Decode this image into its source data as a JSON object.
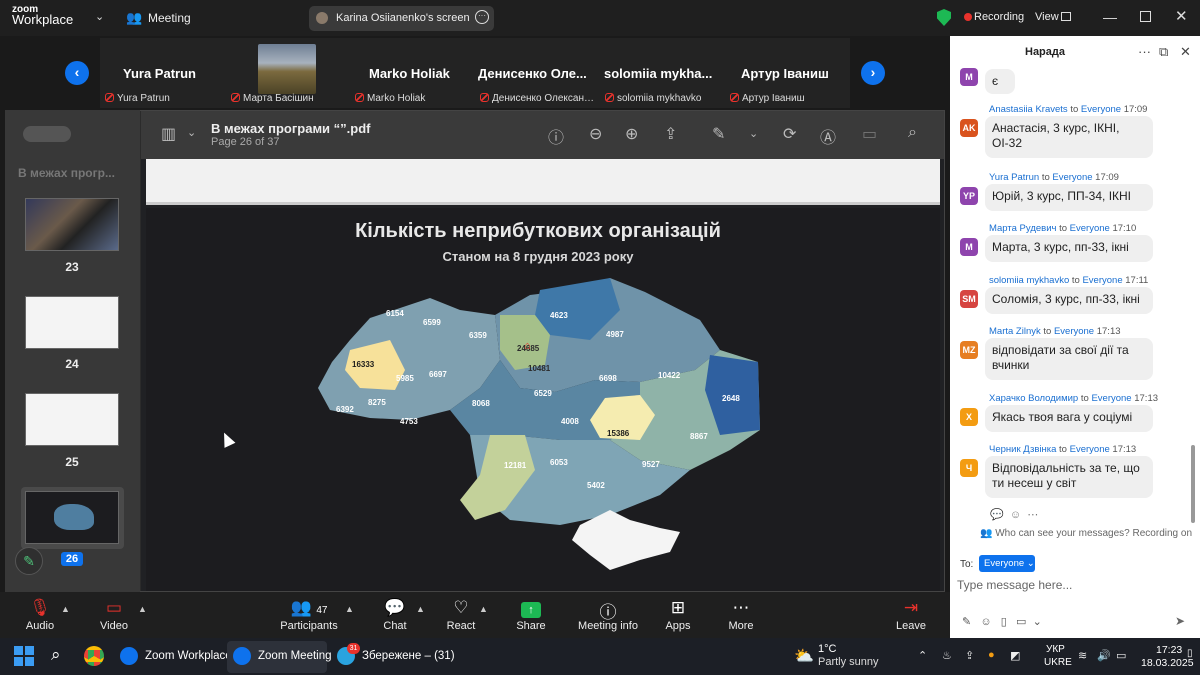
{
  "topbar": {
    "logo_line1": "zoom",
    "logo_line2": "Workplace",
    "meeting_label": "Meeting",
    "screen_share_label": "Karina Osiianenko's screen",
    "recording_label": "Recording",
    "view_label": "View"
  },
  "participants": [
    {
      "name": "Yura Patrun",
      "tile_label": "Yura Patrun"
    },
    {
      "name": "",
      "tile_label": "Марта Басішин"
    },
    {
      "name": "Marko Holiak",
      "tile_label": "Marko Holiak"
    },
    {
      "name": "Денисенко Оле...",
      "tile_label": "Денисенко Олександ..."
    },
    {
      "name": "solomiia mykha...",
      "tile_label": "solomiia mykhavko"
    },
    {
      "name": "Артур Іваниш",
      "tile_label": "Артур Іваниш"
    }
  ],
  "pdf": {
    "sidebar_title": "В межах прогр...",
    "file_title": "В межах програми “”.pdf",
    "page_indicator": "Page 26 of 37",
    "thumbnails": [
      "23",
      "24",
      "25",
      "26"
    ],
    "current_page": "26"
  },
  "slide": {
    "title": "Кількість неприбуткових організацій",
    "subtitle": "Станом на 8 грудня 2023 року",
    "region_values": [
      "6154",
      "6599",
      "6359",
      "4623",
      "4987",
      "16333",
      "5985",
      "6697",
      "24685",
      "10481",
      "6698",
      "10422",
      "6392",
      "8275",
      "8068",
      "6529",
      "2648",
      "4753",
      "4008",
      "15386",
      "8867",
      "12181",
      "6053",
      "9527",
      "5402"
    ]
  },
  "bottombar": {
    "audio": "Audio",
    "video": "Video",
    "participants": "Participants",
    "participants_count": "47",
    "chat": "Chat",
    "react": "React",
    "share": "Share",
    "meeting_info": "Meeting info",
    "apps": "Apps",
    "more": "More",
    "leave": "Leave"
  },
  "chat": {
    "title": "Нарада",
    "first_bubble": "є",
    "first_avatar": "M",
    "to_word": "to",
    "audience": "Everyone",
    "messages": [
      {
        "avatar": "AK",
        "color": "#d9531e",
        "sender": "Anastasiia Kravets",
        "time": "17:09",
        "text": "Анастасія, 3 курс, ІКНІ, ОІ-32"
      },
      {
        "avatar": "YP",
        "color": "#8e44ad",
        "sender": "Yura Patrun",
        "time": "17:09",
        "text": "Юрій, 3 курс, ПП-34, ІКНІ"
      },
      {
        "avatar": "M",
        "color": "#8e44ad",
        "sender": "Марта Рудевич",
        "time": "17:10",
        "text": "Марта, 3 курс, пп-33, ікні"
      },
      {
        "avatar": "SM",
        "color": "#d64541",
        "sender": "solomiia mykhavko",
        "time": "17:11",
        "text": "Соломія, 3 курс, пп-33, ікні"
      },
      {
        "avatar": "MZ",
        "color": "#e67e22",
        "sender": "Marta Zilnyk",
        "time": "17:13",
        "text": "відповідати за свої дії та вчинки"
      },
      {
        "avatar": "X",
        "color": "#f39c12",
        "sender": "Харачко Володимир",
        "time": "17:13",
        "text": "Якась твоя вага у соціумі"
      },
      {
        "avatar": "Ч",
        "color": "#f39c12",
        "sender": "Черник Дзвінка",
        "time": "17:13",
        "text": "Відповідальність за те,  що ти несеш у світ"
      }
    ],
    "privacy_note": "Who can see your messages? Recording on",
    "to_label": "To:",
    "input_placeholder": "Type message here..."
  },
  "taskbar": {
    "zoom_workplace": "Zoom Workplace",
    "zoom_meeting": "Zoom Meeting",
    "telegram": "Збережене – (31)",
    "telegram_badge": "31",
    "weather_temp": "1°C",
    "weather_desc": "Partly sunny",
    "lang_line1": "УКР",
    "lang_line2": "UKRE",
    "time": "17:23",
    "date": "18.03.2025"
  }
}
